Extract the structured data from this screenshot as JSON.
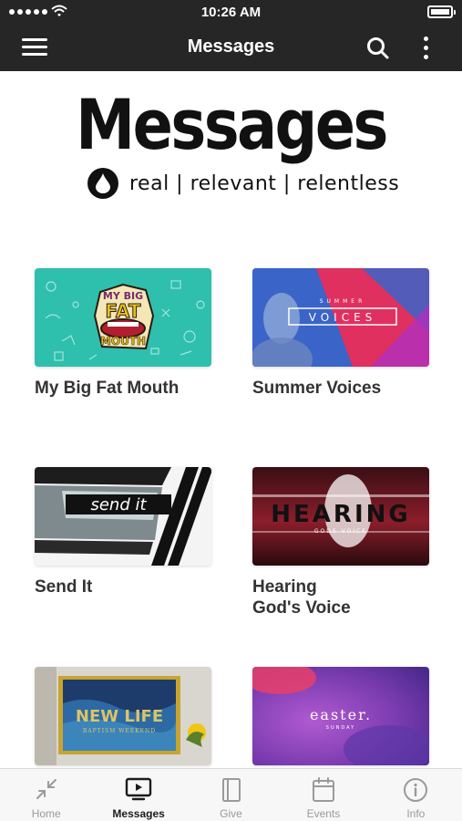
{
  "status_bar": {
    "time": "10:26 AM"
  },
  "nav_bar": {
    "title": "Messages"
  },
  "header": {
    "logo_title": "Messages",
    "tagline": "real | relevant | relentless"
  },
  "series": [
    {
      "title": "My Big Fat Mouth",
      "art_text": [
        "MY BIG",
        "FAT",
        "MOUTH"
      ]
    },
    {
      "title": "Summer Voices",
      "art_text": [
        "SUMMER",
        "VOICES"
      ]
    },
    {
      "title": "Send It",
      "art_text": [
        "send it"
      ]
    },
    {
      "title": "Hearing\nGod's Voice",
      "art_text": [
        "HEARING",
        "GODS VOICE"
      ]
    },
    {
      "title": "",
      "art_text": [
        "NEW LIFE",
        "BAPTISM WEEKEND"
      ]
    },
    {
      "title": "",
      "art_text": [
        "easter.",
        "SUNDAY"
      ]
    }
  ],
  "tab_bar": {
    "tabs": [
      {
        "label": "Home",
        "icon": "collapse-arrows-icon",
        "active": false
      },
      {
        "label": "Messages",
        "icon": "play-screen-icon",
        "active": true
      },
      {
        "label": "Give",
        "icon": "book-icon",
        "active": false
      },
      {
        "label": "Events",
        "icon": "calendar-icon",
        "active": false
      },
      {
        "label": "Info",
        "icon": "info-icon",
        "active": false
      }
    ]
  },
  "colors": {
    "bar_background": "#262626",
    "tab_active": "#1c1c1c",
    "tab_inactive": "#9a9a9a"
  }
}
